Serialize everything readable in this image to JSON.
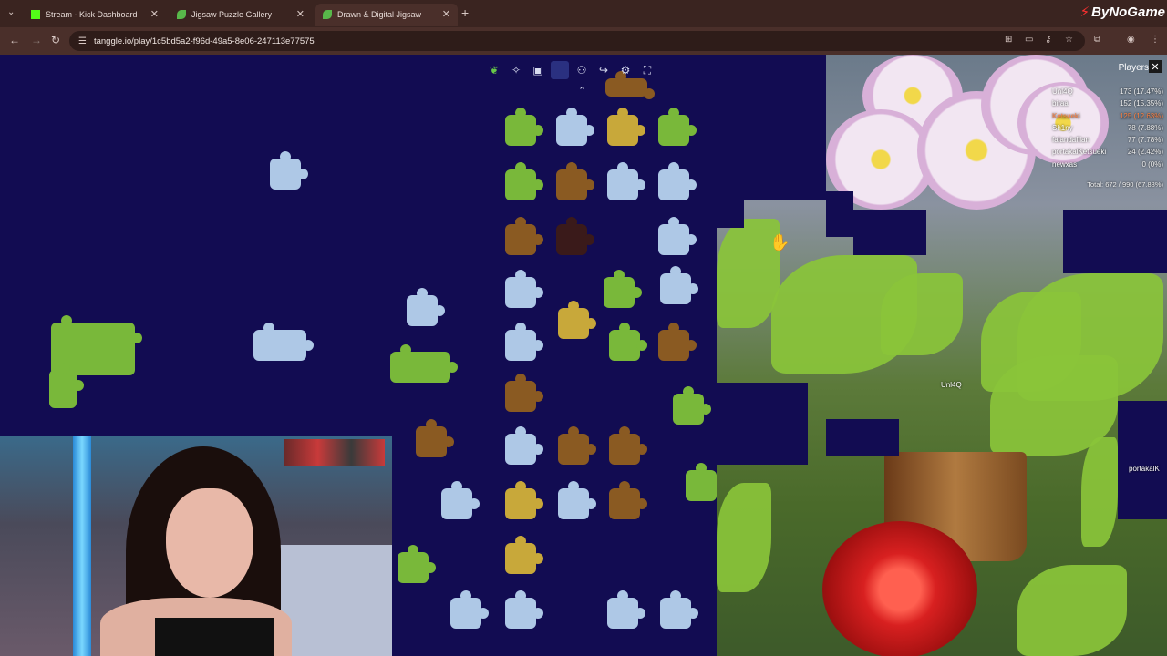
{
  "browser": {
    "tabs": [
      {
        "title": "Stream - Kick Dashboard",
        "active": false
      },
      {
        "title": "Jigsaw Puzzle Gallery",
        "active": false
      },
      {
        "title": "Drawn & Digital Jigsaw",
        "active": true
      }
    ],
    "url": "tanggle.io/play/1c5bd5a2-f96d-49a5-8e06-247113e77575",
    "brand": "ByNoGame"
  },
  "players": {
    "title": "Players",
    "list": [
      {
        "name": "Unl4Q",
        "score": "173 (17.47%)",
        "highlight": false
      },
      {
        "name": "biraa",
        "score": "152 (15.35%)",
        "highlight": false
      },
      {
        "name": "Ketsueki",
        "score": "125 (12.63%)",
        "highlight": true
      },
      {
        "name": "Sh1ny",
        "score": "78 (7.88%)",
        "highlight": false
      },
      {
        "name": "falandafilan",
        "score": "77 (7.78%)",
        "highlight": false
      },
      {
        "name": "portakalKetsueki",
        "score": "24 (2.42%)",
        "highlight": false
      },
      {
        "name": "newxas",
        "score": "0 (0%)",
        "highlight": false
      }
    ],
    "total": "Total: 672 / 990 (67.88%)"
  },
  "cursors": {
    "cursor_1": "Unl4Q",
    "cursor_2": "portakalK"
  },
  "colors": {
    "background": "#120c52",
    "highlight_player": "#ff8040",
    "tab_bar": "#3a2420"
  },
  "icons": {
    "toolbar": [
      "tanggle-logo-icon",
      "puzzle-piece-icon",
      "image-preview-icon",
      "blank-icon",
      "players-icon",
      "share-icon",
      "settings-icon",
      "fullscreen-icon"
    ],
    "collapse": "chevron-double-up-icon"
  }
}
